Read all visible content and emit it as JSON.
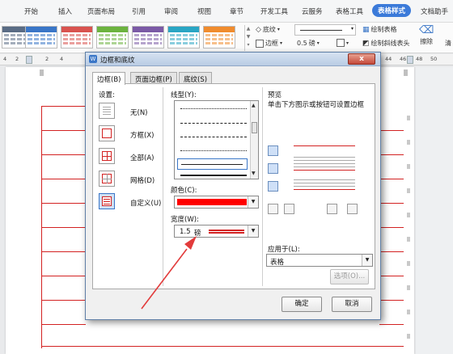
{
  "ribbon_tabs": [
    "开始",
    "插入",
    "页面布局",
    "引用",
    "审阅",
    "视图",
    "章节",
    "开发工具",
    "云服务",
    "表格工具",
    "表格样式",
    "文档助手"
  ],
  "active_tab": "表格样式",
  "ribbon": {
    "shading_label": "底纹",
    "border_label": "边框",
    "width_value": "0.5",
    "width_unit": "磅",
    "draw_table": "绘制表格",
    "draw_diag": "绘制斜线表头",
    "erase": "擦除",
    "clear": "清"
  },
  "ruler_ticks": [
    "4",
    "2",
    "2",
    "4",
    "44",
    "46",
    "48",
    "50"
  ],
  "dialog": {
    "title": "边框和底纹",
    "close_glyph": "x",
    "tabs": [
      "边框(B)",
      "页面边框(P)",
      "底纹(S)"
    ],
    "settings_label": "设置:",
    "settings": [
      "无(N)",
      "方框(X)",
      "全部(A)",
      "网格(D)",
      "自定义(U)"
    ],
    "linetype_label": "线型(Y):",
    "color_label": "颜色(C):",
    "width_label": "宽度(W):",
    "width_value": "1.5",
    "width_unit": "磅",
    "preview_label": "预览",
    "preview_hint": "单击下方图示或按钮可设置边框",
    "apply_label": "应用于(L):",
    "apply_value": "表格",
    "options_button": "选项(O)...",
    "ok_button": "确定",
    "cancel_button": "取消"
  },
  "colors": {
    "accent": "#3b7ad9",
    "border_color": "#ff0000",
    "arrow_color": "#e23b3b",
    "table_line": "#d32222"
  }
}
